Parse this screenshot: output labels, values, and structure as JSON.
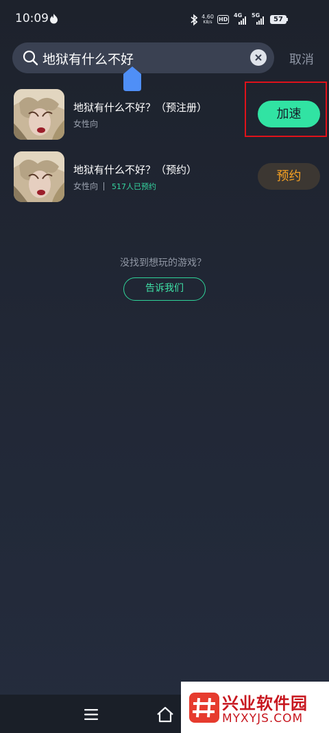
{
  "status_bar": {
    "time": "10:09",
    "net_speed_value": "4.60",
    "net_speed_unit": "KB/s",
    "hd_label": "HD",
    "sim1_label": "4G",
    "sim2_label": "5G",
    "battery": "57",
    "icons": [
      "flame-icon",
      "bluetooth-icon",
      "signal-icon",
      "battery-icon"
    ]
  },
  "search": {
    "query": "地狱有什么不好",
    "cancel_label": "取消",
    "icons": [
      "search-icon",
      "clear-icon"
    ]
  },
  "results": [
    {
      "title": "地狱有什么不好？（预注册）",
      "tag": "女性向",
      "action_label": "加速",
      "action_color": "#31e3a3"
    },
    {
      "title": "地狱有什么不好？（预约）",
      "tag": "女性向",
      "reserve_count": "517人已预约",
      "action_label": "预约",
      "action_color": "#f5a023"
    }
  ],
  "empty_hint": {
    "text": "没找到想玩的游戏？",
    "button_label": "告诉我们"
  },
  "nav_bar": {
    "icons": [
      "menu-icon",
      "home-icon"
    ]
  },
  "watermark": {
    "title": "兴业软件园",
    "domain": "MYXYJS.COM"
  },
  "colors": {
    "background": "#212735",
    "accent_green": "#31e3a3",
    "accent_orange": "#f5a023",
    "highlight_red": "#e0121a"
  }
}
